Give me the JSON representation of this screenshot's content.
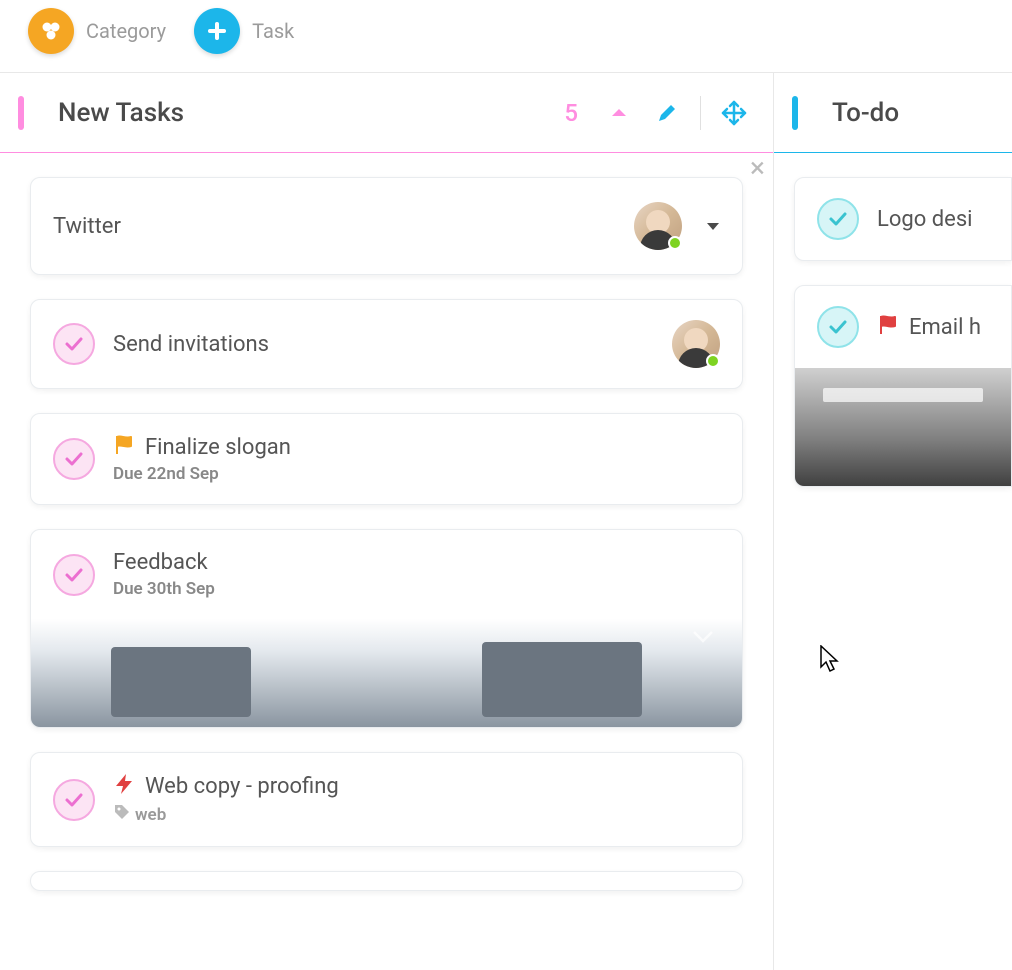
{
  "toolbar": {
    "category_label": "Category",
    "task_label": "Task"
  },
  "columns": {
    "new_tasks": {
      "title": "New Tasks",
      "count": "5",
      "accent_color": "#ff8de0"
    },
    "todo": {
      "title": "To-do",
      "accent_color": "#1cb6ea"
    }
  },
  "new_tasks_items": [
    {
      "title": "Twitter",
      "has_avatar": true,
      "avatar_caret": true,
      "closeable": true
    },
    {
      "title": "Send invitations",
      "check_color": "pink",
      "has_avatar": true
    },
    {
      "title": "Finalize slogan",
      "check_color": "pink",
      "flag": true,
      "flag_color": "#f5a623",
      "due": "Due 22nd Sep"
    },
    {
      "title": "Feedback",
      "check_color": "pink",
      "due": "Due 30th Sep",
      "has_image": true
    },
    {
      "title": "Web copy - proofing",
      "check_color": "pink",
      "bolt": true,
      "bolt_color": "#e04040",
      "tag": "web"
    }
  ],
  "todo_items": [
    {
      "title": "Logo desi",
      "check_color": "cyan"
    },
    {
      "title": "Email h",
      "check_color": "cyan",
      "flag": true,
      "flag_color": "#e04040",
      "has_image": true
    }
  ]
}
